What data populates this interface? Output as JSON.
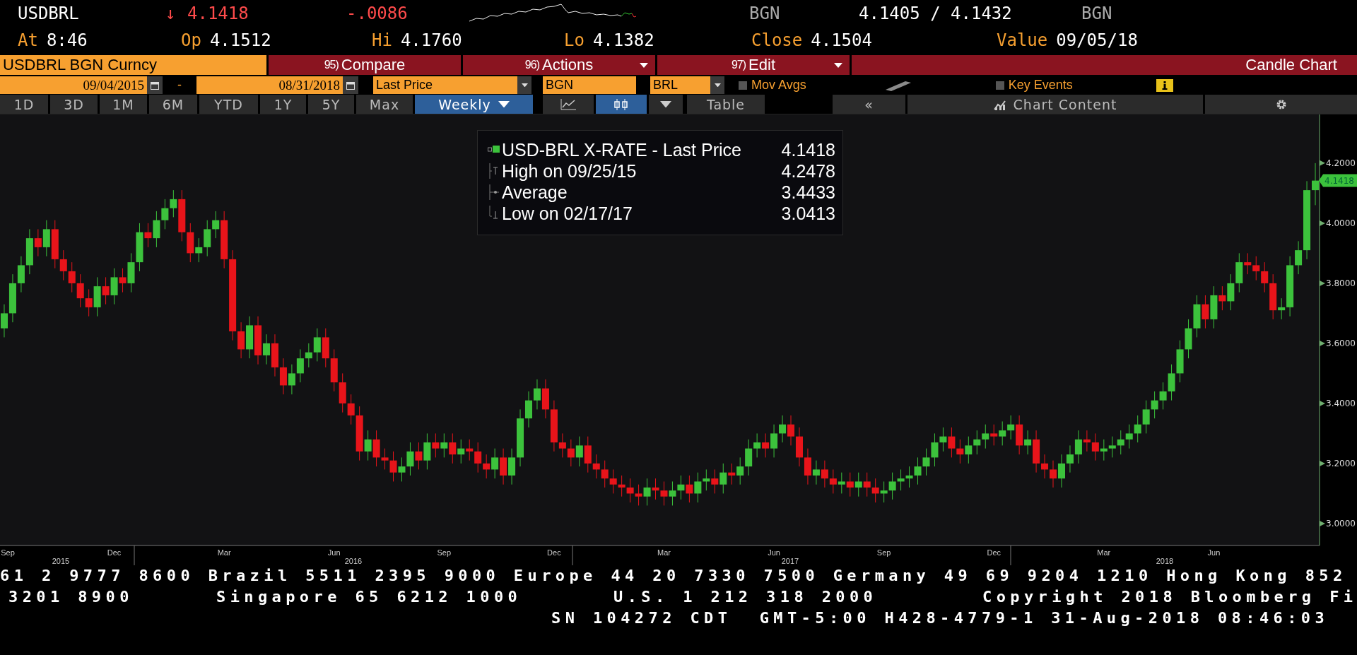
{
  "header": {
    "ticker": "USDBRL",
    "direction": "↓",
    "last": "4.1418",
    "change": "-.0086",
    "source_left": "BGN",
    "bid_ask": "4.1405 / 4.1432",
    "source_right": "BGN",
    "stats": [
      {
        "label": "At",
        "value": "8:46"
      },
      {
        "label": "Op",
        "value": "4.1512"
      },
      {
        "label": "Hi",
        "value": "4.1760"
      },
      {
        "label": "Lo",
        "value": "4.1382"
      },
      {
        "label": "Close",
        "value": "4.1504"
      },
      {
        "label": "Value",
        "value": "09/05/18"
      }
    ]
  },
  "command_bar": {
    "security": "USDBRL BGN Curncy",
    "menus": [
      {
        "number": "95)",
        "label": "Compare",
        "dropdown": false
      },
      {
        "number": "96)",
        "label": "Actions",
        "dropdown": true
      },
      {
        "number": "97)",
        "label": "Edit",
        "dropdown": true
      }
    ],
    "chart_type": "Candle Chart"
  },
  "settings": {
    "start_date": "09/04/2015",
    "separator": "-",
    "end_date": "08/31/2018",
    "field": "Last Price",
    "source": "BGN",
    "currency": "BRL",
    "options": [
      {
        "label": "Mov Avgs",
        "checked": false
      },
      {
        "label": "Key Events",
        "checked": false
      }
    ]
  },
  "ranges": [
    {
      "label": "1D",
      "selected": false
    },
    {
      "label": "3D",
      "selected": false
    },
    {
      "label": "1M",
      "selected": false
    },
    {
      "label": "6M",
      "selected": false
    },
    {
      "label": "YTD",
      "selected": false
    },
    {
      "label": "1Y",
      "selected": false
    },
    {
      "label": "5Y",
      "selected": false
    },
    {
      "label": "Max",
      "selected": false
    }
  ],
  "frequency": "Weekly",
  "chart_views": [
    {
      "kind": "line",
      "selected": false
    },
    {
      "kind": "candle",
      "selected": true
    }
  ],
  "table_button": "Table",
  "collapse": "«",
  "chart_content": "Chart Content",
  "legend": [
    {
      "kind": "series",
      "label": "USD-BRL X-RATE - Last Price",
      "value": "4.1418"
    },
    {
      "kind": "high",
      "label": "High on 09/25/15",
      "value": "4.2478"
    },
    {
      "kind": "average",
      "label": "Average",
      "value": "3.4433"
    },
    {
      "kind": "low",
      "label": "Low on 02/17/17",
      "value": "3.0413"
    }
  ],
  "chart": {
    "last_tag": "4.1418",
    "years": [
      "2015",
      "2016",
      "2017",
      "2018"
    ],
    "chart_data": {
      "type": "candlestick",
      "ylim": [
        2.927,
        4.362
      ],
      "yticks": [
        {
          "value": 4.2,
          "label": "4.2000"
        },
        {
          "value": 4.0,
          "label": "4.0000"
        },
        {
          "value": 3.8,
          "label": "3.8000"
        },
        {
          "value": 3.6,
          "label": "3.6000"
        },
        {
          "value": 3.4,
          "label": "3.4000"
        },
        {
          "value": 3.2,
          "label": "3.2000"
        },
        {
          "value": 3.0,
          "label": "3.0000"
        }
      ],
      "categories": [
        "Sep",
        null,
        null,
        null,
        null,
        null,
        null,
        null,
        null,
        null,
        null,
        null,
        null,
        "Dec",
        null,
        null,
        null,
        null,
        null,
        null,
        null,
        null,
        null,
        null,
        null,
        null,
        "Mar",
        null,
        null,
        null,
        null,
        null,
        null,
        null,
        null,
        null,
        null,
        null,
        null,
        "Jun",
        null,
        null,
        null,
        null,
        null,
        null,
        null,
        null,
        null,
        null,
        null,
        null,
        "Sep",
        null,
        null,
        null,
        null,
        null,
        null,
        null,
        null,
        null,
        null,
        null,
        null,
        "Dec",
        null,
        null,
        null,
        null,
        null,
        null,
        null,
        null,
        null,
        null,
        null,
        null,
        "Mar",
        null,
        null,
        null,
        null,
        null,
        null,
        null,
        null,
        null,
        null,
        null,
        null,
        "Jun",
        null,
        null,
        null,
        null,
        null,
        null,
        null,
        null,
        null,
        null,
        null,
        null,
        "Sep",
        null,
        null,
        null,
        null,
        null,
        null,
        null,
        null,
        null,
        null,
        null,
        null,
        "Dec",
        null,
        null,
        null,
        null,
        null,
        null,
        null,
        null,
        null,
        null,
        null,
        null,
        "Mar",
        null,
        null,
        null,
        null,
        null,
        null,
        null,
        null,
        null,
        null,
        null,
        null,
        "Jun",
        null,
        null,
        null,
        null,
        null,
        null,
        null,
        null,
        null,
        null,
        null,
        null
      ],
      "ohlc": [
        [
          3.65,
          3.73,
          3.62,
          3.7
        ],
        [
          3.7,
          3.83,
          3.67,
          3.8
        ],
        [
          3.8,
          3.89,
          3.77,
          3.86
        ],
        [
          3.86,
          3.98,
          3.83,
          3.95
        ],
        [
          3.95,
          3.98,
          3.89,
          3.92
        ],
        [
          3.92,
          4.01,
          3.89,
          3.98
        ],
        [
          3.98,
          4.01,
          3.85,
          3.88
        ],
        [
          3.88,
          3.91,
          3.81,
          3.84
        ],
        [
          3.84,
          3.87,
          3.77,
          3.8
        ],
        [
          3.8,
          3.83,
          3.72,
          3.75
        ],
        [
          3.75,
          3.78,
          3.69,
          3.72
        ],
        [
          3.72,
          3.82,
          3.69,
          3.79
        ],
        [
          3.79,
          3.82,
          3.73,
          3.76
        ],
        [
          3.76,
          3.85,
          3.73,
          3.82
        ],
        [
          3.82,
          3.85,
          3.77,
          3.8
        ],
        [
          3.8,
          3.9,
          3.77,
          3.87
        ],
        [
          3.87,
          4.0,
          3.84,
          3.97
        ],
        [
          3.97,
          4.0,
          3.92,
          3.95
        ],
        [
          3.95,
          4.04,
          3.92,
          4.01
        ],
        [
          4.01,
          4.08,
          3.98,
          4.05
        ],
        [
          4.05,
          4.11,
          4.02,
          4.08
        ],
        [
          4.08,
          4.11,
          3.94,
          3.97
        ],
        [
          3.97,
          4.0,
          3.87,
          3.9
        ],
        [
          3.9,
          3.95,
          3.87,
          3.92
        ],
        [
          3.92,
          4.01,
          3.89,
          3.98
        ],
        [
          3.98,
          4.04,
          3.95,
          4.01
        ],
        [
          4.01,
          4.04,
          3.85,
          3.88
        ],
        [
          3.88,
          3.91,
          3.61,
          3.64
        ],
        [
          3.64,
          3.67,
          3.55,
          3.58
        ],
        [
          3.58,
          3.69,
          3.55,
          3.66
        ],
        [
          3.66,
          3.69,
          3.53,
          3.56
        ],
        [
          3.56,
          3.63,
          3.53,
          3.6
        ],
        [
          3.6,
          3.63,
          3.49,
          3.52
        ],
        [
          3.52,
          3.55,
          3.43,
          3.46
        ],
        [
          3.46,
          3.53,
          3.43,
          3.5
        ],
        [
          3.5,
          3.58,
          3.47,
          3.55
        ],
        [
          3.55,
          3.6,
          3.52,
          3.57
        ],
        [
          3.57,
          3.65,
          3.54,
          3.62
        ],
        [
          3.62,
          3.65,
          3.52,
          3.55
        ],
        [
          3.55,
          3.58,
          3.44,
          3.47
        ],
        [
          3.47,
          3.5,
          3.37,
          3.4
        ],
        [
          3.4,
          3.43,
          3.33,
          3.36
        ],
        [
          3.36,
          3.39,
          3.21,
          3.24
        ],
        [
          3.24,
          3.31,
          3.21,
          3.28
        ],
        [
          3.28,
          3.31,
          3.19,
          3.22
        ],
        [
          3.22,
          3.25,
          3.18,
          3.21
        ],
        [
          3.21,
          3.24,
          3.14,
          3.17
        ],
        [
          3.17,
          3.22,
          3.14,
          3.19
        ],
        [
          3.19,
          3.27,
          3.16,
          3.24
        ],
        [
          3.24,
          3.27,
          3.18,
          3.21
        ],
        [
          3.21,
          3.3,
          3.18,
          3.27
        ],
        [
          3.27,
          3.3,
          3.22,
          3.25
        ],
        [
          3.25,
          3.3,
          3.22,
          3.27
        ],
        [
          3.27,
          3.3,
          3.2,
          3.23
        ],
        [
          3.23,
          3.28,
          3.2,
          3.25
        ],
        [
          3.25,
          3.28,
          3.21,
          3.24
        ],
        [
          3.24,
          3.27,
          3.17,
          3.2
        ],
        [
          3.2,
          3.23,
          3.15,
          3.18
        ],
        [
          3.18,
          3.25,
          3.15,
          3.22
        ],
        [
          3.22,
          3.25,
          3.13,
          3.16
        ],
        [
          3.16,
          3.25,
          3.13,
          3.22
        ],
        [
          3.22,
          3.38,
          3.19,
          3.35
        ],
        [
          3.35,
          3.44,
          3.32,
          3.41
        ],
        [
          3.41,
          3.48,
          3.38,
          3.45
        ],
        [
          3.45,
          3.48,
          3.35,
          3.38
        ],
        [
          3.38,
          3.41,
          3.24,
          3.27
        ],
        [
          3.27,
          3.3,
          3.22,
          3.25
        ],
        [
          3.25,
          3.28,
          3.19,
          3.22
        ],
        [
          3.22,
          3.29,
          3.19,
          3.26
        ],
        [
          3.26,
          3.29,
          3.17,
          3.2
        ],
        [
          3.2,
          3.23,
          3.15,
          3.18
        ],
        [
          3.18,
          3.21,
          3.12,
          3.15
        ],
        [
          3.15,
          3.18,
          3.1,
          3.13
        ],
        [
          3.13,
          3.16,
          3.09,
          3.12
        ],
        [
          3.12,
          3.15,
          3.07,
          3.1
        ],
        [
          3.1,
          3.13,
          3.06,
          3.09
        ],
        [
          3.09,
          3.15,
          3.06,
          3.12
        ],
        [
          3.12,
          3.15,
          3.08,
          3.11
        ],
        [
          3.11,
          3.14,
          3.06,
          3.09
        ],
        [
          3.09,
          3.14,
          3.06,
          3.11
        ],
        [
          3.11,
          3.16,
          3.08,
          3.13
        ],
        [
          3.13,
          3.16,
          3.07,
          3.1
        ],
        [
          3.1,
          3.17,
          3.07,
          3.14
        ],
        [
          3.14,
          3.18,
          3.11,
          3.15
        ],
        [
          3.15,
          3.18,
          3.1,
          3.13
        ],
        [
          3.13,
          3.2,
          3.1,
          3.17
        ],
        [
          3.17,
          3.2,
          3.13,
          3.16
        ],
        [
          3.16,
          3.22,
          3.13,
          3.19
        ],
        [
          3.19,
          3.28,
          3.16,
          3.25
        ],
        [
          3.25,
          3.3,
          3.22,
          3.27
        ],
        [
          3.27,
          3.3,
          3.22,
          3.25
        ],
        [
          3.25,
          3.33,
          3.22,
          3.3
        ],
        [
          3.3,
          3.36,
          3.27,
          3.33
        ],
        [
          3.33,
          3.36,
          3.26,
          3.29
        ],
        [
          3.29,
          3.32,
          3.19,
          3.22
        ],
        [
          3.22,
          3.25,
          3.13,
          3.16
        ],
        [
          3.16,
          3.21,
          3.13,
          3.18
        ],
        [
          3.18,
          3.21,
          3.12,
          3.15
        ],
        [
          3.15,
          3.18,
          3.1,
          3.13
        ],
        [
          3.13,
          3.17,
          3.1,
          3.14
        ],
        [
          3.14,
          3.17,
          3.09,
          3.12
        ],
        [
          3.12,
          3.17,
          3.09,
          3.14
        ],
        [
          3.14,
          3.17,
          3.09,
          3.12
        ],
        [
          3.12,
          3.15,
          3.07,
          3.1
        ],
        [
          3.1,
          3.14,
          3.07,
          3.11
        ],
        [
          3.11,
          3.17,
          3.08,
          3.14
        ],
        [
          3.14,
          3.18,
          3.11,
          3.15
        ],
        [
          3.15,
          3.19,
          3.12,
          3.16
        ],
        [
          3.16,
          3.22,
          3.13,
          3.19
        ],
        [
          3.19,
          3.25,
          3.16,
          3.22
        ],
        [
          3.22,
          3.3,
          3.19,
          3.27
        ],
        [
          3.27,
          3.32,
          3.24,
          3.29
        ],
        [
          3.29,
          3.32,
          3.22,
          3.25
        ],
        [
          3.25,
          3.28,
          3.2,
          3.23
        ],
        [
          3.23,
          3.29,
          3.2,
          3.26
        ],
        [
          3.26,
          3.31,
          3.23,
          3.28
        ],
        [
          3.28,
          3.33,
          3.25,
          3.3
        ],
        [
          3.3,
          3.33,
          3.26,
          3.29
        ],
        [
          3.29,
          3.34,
          3.26,
          3.31
        ],
        [
          3.31,
          3.36,
          3.28,
          3.33
        ],
        [
          3.33,
          3.36,
          3.23,
          3.26
        ],
        [
          3.26,
          3.31,
          3.23,
          3.28
        ],
        [
          3.28,
          3.31,
          3.17,
          3.2
        ],
        [
          3.2,
          3.23,
          3.15,
          3.18
        ],
        [
          3.18,
          3.21,
          3.12,
          3.15
        ],
        [
          3.15,
          3.23,
          3.12,
          3.2
        ],
        [
          3.2,
          3.26,
          3.17,
          3.23
        ],
        [
          3.23,
          3.31,
          3.2,
          3.28
        ],
        [
          3.28,
          3.31,
          3.24,
          3.27
        ],
        [
          3.27,
          3.3,
          3.21,
          3.24
        ],
        [
          3.24,
          3.28,
          3.21,
          3.25
        ],
        [
          3.25,
          3.29,
          3.22,
          3.26
        ],
        [
          3.26,
          3.31,
          3.23,
          3.28
        ],
        [
          3.28,
          3.33,
          3.25,
          3.3
        ],
        [
          3.3,
          3.36,
          3.27,
          3.33
        ],
        [
          3.33,
          3.41,
          3.3,
          3.38
        ],
        [
          3.38,
          3.44,
          3.35,
          3.41
        ],
        [
          3.41,
          3.47,
          3.38,
          3.44
        ],
        [
          3.44,
          3.53,
          3.41,
          3.5
        ],
        [
          3.5,
          3.61,
          3.47,
          3.58
        ],
        [
          3.58,
          3.68,
          3.55,
          3.65
        ],
        [
          3.65,
          3.76,
          3.62,
          3.73
        ],
        [
          3.73,
          3.76,
          3.65,
          3.68
        ],
        [
          3.68,
          3.79,
          3.65,
          3.76
        ],
        [
          3.76,
          3.79,
          3.71,
          3.74
        ],
        [
          3.74,
          3.83,
          3.71,
          3.8
        ],
        [
          3.8,
          3.9,
          3.77,
          3.87
        ],
        [
          3.87,
          3.9,
          3.83,
          3.86
        ],
        [
          3.86,
          3.89,
          3.81,
          3.84
        ],
        [
          3.84,
          3.87,
          3.77,
          3.8
        ],
        [
          3.8,
          3.83,
          3.68,
          3.71
        ],
        [
          3.71,
          3.75,
          3.68,
          3.72
        ],
        [
          3.72,
          3.89,
          3.69,
          3.86
        ],
        [
          3.86,
          3.94,
          3.83,
          3.91
        ],
        [
          3.91,
          4.14,
          3.88,
          4.11
        ],
        [
          4.11,
          4.2,
          4.06,
          4.1418
        ]
      ]
    }
  },
  "footer": {
    "line_1": "61 2 9777 8600 Brazil 5511 2395 9000 Europe 44 20 7330 7500 Germany 49 69 9204 1210 Hong Kong 852",
    "line_2": [
      "3201 8900",
      "Singapore 65 6212 1000",
      "U.S. 1 212 318 2000",
      "Copyright 2018 Bloomberg Fi"
    ],
    "line_3": "SN 104272 CDT  GMT-5:00 H428-4779-1 31-Aug-2018 08:46:03"
  }
}
